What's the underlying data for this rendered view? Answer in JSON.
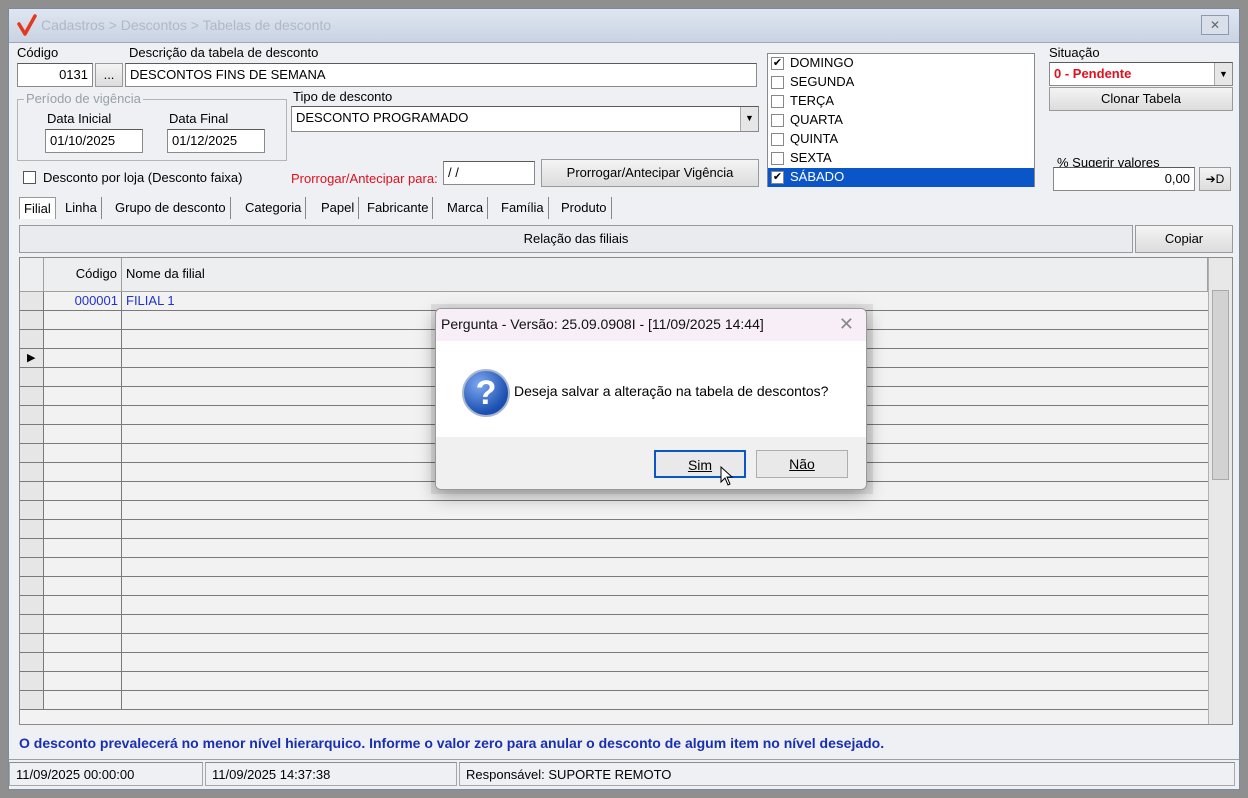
{
  "window": {
    "title": "Cadastros > Descontos > Tabelas de desconto",
    "close_label": "✕"
  },
  "form": {
    "codigo_label": "Código",
    "codigo_value": "0131",
    "ellipsis_label": "...",
    "descricao_label": "Descrição da tabela de desconto",
    "descricao_value": "DESCONTOS FINS DE SEMANA",
    "periodo_title": "Período de vigência",
    "data_inicial_label": "Data Inicial",
    "data_inicial_value": "01/10/2025",
    "data_final_label": "Data Final",
    "data_final_value": "01/12/2025",
    "tipo_label": "Tipo de desconto",
    "tipo_value": "DESCONTO PROGRAMADO",
    "desconto_loja_label": "Desconto por loja (Desconto faixa)",
    "prorrogar_label": "Prorrogar/Antecipar para:",
    "prorrogar_value": " / /",
    "prorrogar_button": "Prorrogar/Antecipar Vigência",
    "situacao_label": "Situação",
    "situacao_value": "0 - Pendente",
    "clonar_button": "Clonar Tabela",
    "sugerir_label": "% Sugerir valores",
    "sugerir_value": "0,00",
    "sugerir_button": "➔D"
  },
  "days": [
    {
      "label": "DOMINGO",
      "checked": true,
      "selected": false
    },
    {
      "label": "SEGUNDA",
      "checked": false,
      "selected": false
    },
    {
      "label": "TERÇA",
      "checked": false,
      "selected": false
    },
    {
      "label": "QUARTA",
      "checked": false,
      "selected": false
    },
    {
      "label": "QUINTA",
      "checked": false,
      "selected": false
    },
    {
      "label": "SEXTA",
      "checked": false,
      "selected": false
    },
    {
      "label": "SÁBADO",
      "checked": true,
      "selected": true
    }
  ],
  "tabs": [
    "Filial",
    "Linha",
    "Grupo de desconto",
    "Categoria",
    "Papel",
    "Fabricante",
    "Marca",
    "Família",
    "Produto"
  ],
  "grid": {
    "section_title": "Relação das filiais",
    "copy_button": "Copiar",
    "col_codigo": "Código",
    "col_nome": "Nome da filial",
    "rows": [
      {
        "codigo": "000001",
        "nome": "FILIAL 1"
      }
    ]
  },
  "info_text": "O desconto prevalecerá no menor nível hierarquico. Informe o valor zero para anular o desconto de algum item no nível desejado.",
  "status": {
    "date1": "11/09/2025 00:00:00",
    "date2": "11/09/2025 14:37:38",
    "responsavel": "Responsável: SUPORTE REMOTO"
  },
  "dialog": {
    "title": "Pergunta - Versão: 25.09.0908I - [11/09/2025 14:44]",
    "message": "Deseja salvar a alteração na tabela de descontos?",
    "yes_label": "Sim",
    "no_label": "Não",
    "icon": "question-icon"
  },
  "colors": {
    "accent_blue": "#0a56c8",
    "status_red": "#e0101e",
    "info_blue": "#1a2fb0"
  }
}
